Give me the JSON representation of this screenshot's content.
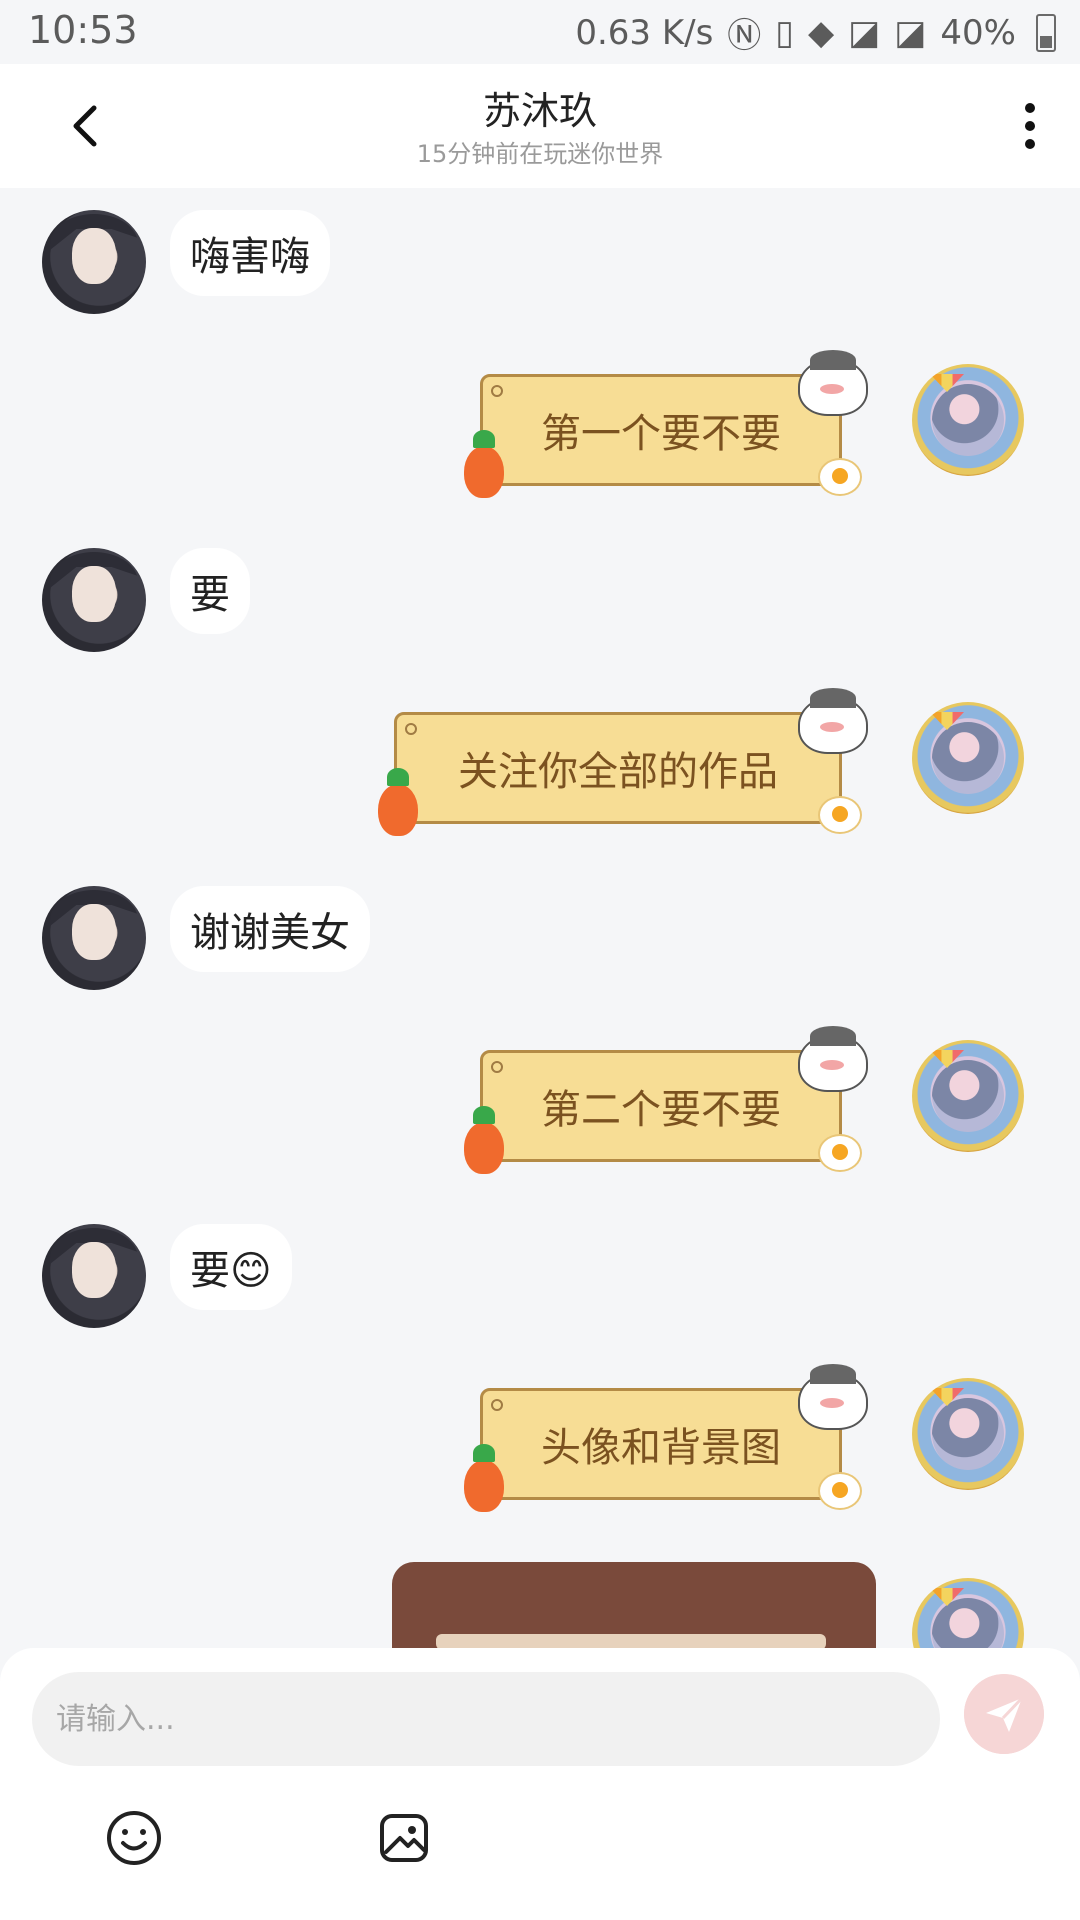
{
  "status_bar": {
    "time": "10:53",
    "network_speed": "0.63 K/s",
    "battery": "40%"
  },
  "header": {
    "title": "苏沐玖",
    "subtitle": "15分钟前在玩迷你世界"
  },
  "messages": [
    {
      "side": "left",
      "text": "嗨害嗨"
    },
    {
      "side": "right",
      "text": "第一个要不要"
    },
    {
      "side": "left",
      "text": "要"
    },
    {
      "side": "right",
      "text": "关注你全部的作品"
    },
    {
      "side": "left",
      "text": "谢谢美女"
    },
    {
      "side": "right",
      "text": "第二个要不要"
    },
    {
      "side": "left",
      "text": "要😊"
    },
    {
      "side": "right",
      "text": "头像和背景图"
    },
    {
      "side": "right",
      "type": "image"
    }
  ],
  "input": {
    "placeholder": "请输入..."
  },
  "toolbar": {
    "emoji_icon": "emoji-icon",
    "image_icon": "image-icon",
    "send_icon": "send-icon"
  },
  "colors": {
    "background": "#f5f6f8",
    "bubble_left": "#ffffff",
    "bubble_right": "#f7dd95",
    "bubble_right_text": "#7b5220",
    "send_button": "#f6d6d6"
  }
}
